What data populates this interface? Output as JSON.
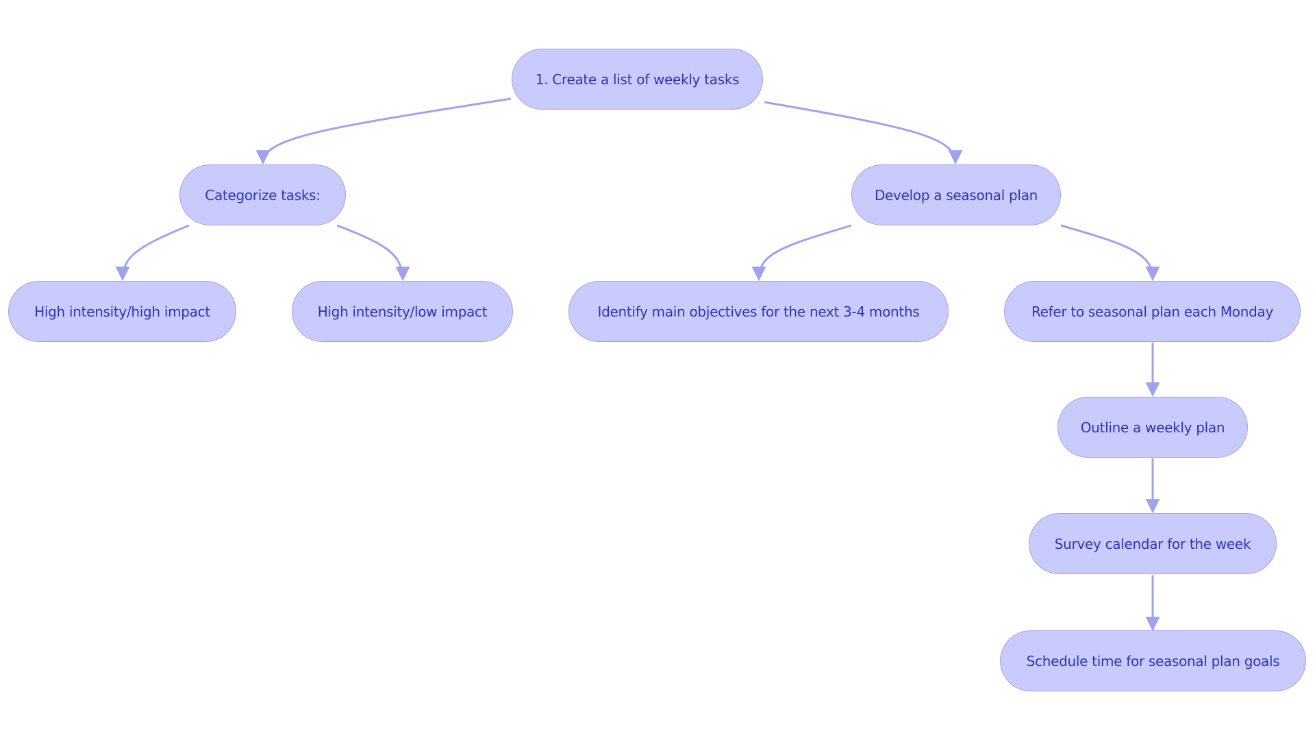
{
  "colors": {
    "node_fill": "#c9cbfd",
    "node_stroke": "#9ea2ee",
    "text": "#3232b0",
    "edge": "#9fa3ee"
  },
  "nodes": {
    "root": "1. Create a list of weekly tasks",
    "categorize": "Categorize tasks:",
    "develop": "Develop a seasonal plan",
    "high_high": "High intensity/high impact",
    "high_low": "High intensity/low impact",
    "identify": "Identify main objectives for the next 3-4 months",
    "refer": "Refer to seasonal plan each Monday",
    "outline": "Outline a weekly plan",
    "survey": "Survey calendar for the week",
    "schedule": "Schedule time for seasonal plan goals"
  },
  "edges": [
    [
      "root",
      "categorize"
    ],
    [
      "root",
      "develop"
    ],
    [
      "categorize",
      "high_high"
    ],
    [
      "categorize",
      "high_low"
    ],
    [
      "develop",
      "identify"
    ],
    [
      "develop",
      "refer"
    ],
    [
      "refer",
      "outline"
    ],
    [
      "outline",
      "survey"
    ],
    [
      "survey",
      "schedule"
    ]
  ]
}
